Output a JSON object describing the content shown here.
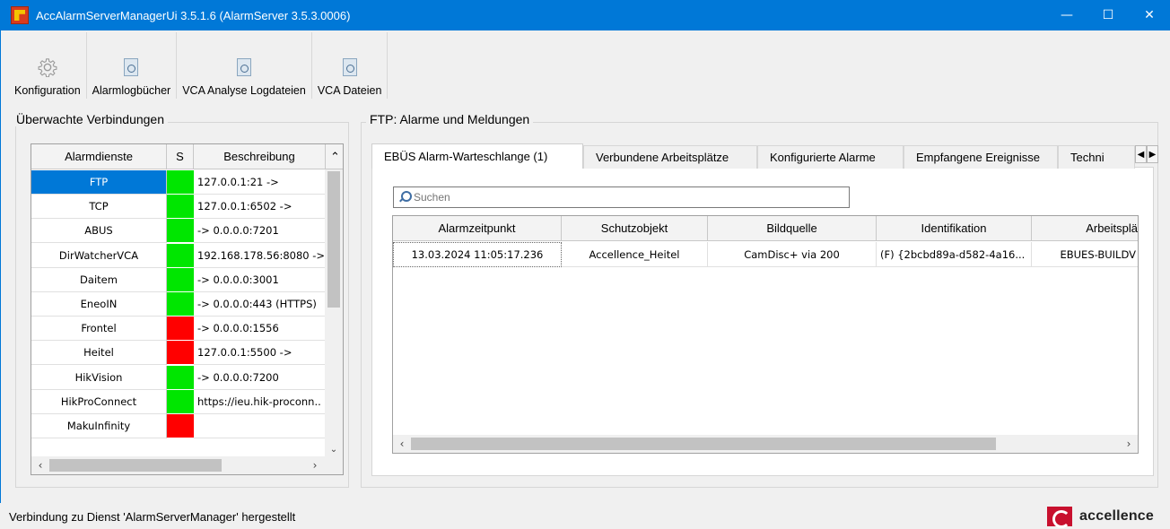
{
  "window": {
    "title": "AccAlarmServerManagerUi 3.5.1.6 (AlarmServer 3.5.3.0006)",
    "minimize": "—",
    "maximize": "☐",
    "close": "✕"
  },
  "toolbar": {
    "items": [
      {
        "label": "Konfiguration",
        "icon": "gear-icon"
      },
      {
        "label": "Alarmlogbücher",
        "icon": "document-icon"
      },
      {
        "label": "VCA Analyse Logdateien",
        "icon": "document-icon"
      },
      {
        "label": "VCA Dateien",
        "icon": "document-icon"
      }
    ]
  },
  "left_panel": {
    "title": "Überwachte Verbindungen",
    "columns": [
      "Alarmdienste",
      "S",
      "Beschreibung"
    ],
    "status_colors": {
      "ok": "#00e600",
      "error": "#ff0000"
    },
    "rows": [
      {
        "name": "FTP",
        "status": "ok",
        "desc": "127.0.0.1:21 ->"
      },
      {
        "name": "TCP",
        "status": "ok",
        "desc": "127.0.0.1:6502 ->"
      },
      {
        "name": "ABUS",
        "status": "ok",
        "desc": "-> 0.0.0.0:7201"
      },
      {
        "name": "DirWatcherVCA",
        "status": "ok",
        "desc": "192.168.178.56:8080 ->"
      },
      {
        "name": "Daitem",
        "status": "ok",
        "desc": "-> 0.0.0.0:3001"
      },
      {
        "name": "EneoIN",
        "status": "ok",
        "desc": "-> 0.0.0.0:443 (HTTPS)"
      },
      {
        "name": "Frontel",
        "status": "error",
        "desc": "-> 0.0.0.0:1556"
      },
      {
        "name": "Heitel",
        "status": "error",
        "desc": "127.0.0.1:5500 ->"
      },
      {
        "name": "HikVision",
        "status": "ok",
        "desc": "-> 0.0.0.0:7200"
      },
      {
        "name": "HikProConnect",
        "status": "ok",
        "desc": "https://ieu.hik-proconn.."
      },
      {
        "name": "MakuInfinity",
        "status": "error",
        "desc": ""
      }
    ]
  },
  "right_panel": {
    "title": "FTP: Alarme und Meldungen",
    "tabs": [
      {
        "label": "EBÜS Alarm-Warteschlange (1)",
        "active": true
      },
      {
        "label": "Verbundene Arbeitsplätze"
      },
      {
        "label": "Konfigurierte Alarme"
      },
      {
        "label": "Empfangene Ereignisse"
      },
      {
        "label": "Techni"
      }
    ],
    "search": {
      "placeholder": "Suchen"
    },
    "columns": [
      "Alarmzeitpunkt",
      "Schutzobjekt",
      "Bildquelle",
      "Identifikation",
      "Arbeitsplä"
    ],
    "rows": [
      [
        "13.03.2024 11:05:17.236",
        "Accellence_Heitel",
        "CamDisc+ via 200",
        "(F) {2bcbd89a-d582-4a16...",
        "EBUES-BUILDV"
      ]
    ]
  },
  "status": {
    "text": "Verbindung zu Dienst 'AlarmServerManager' hergestellt",
    "logo_text": "accellence"
  }
}
